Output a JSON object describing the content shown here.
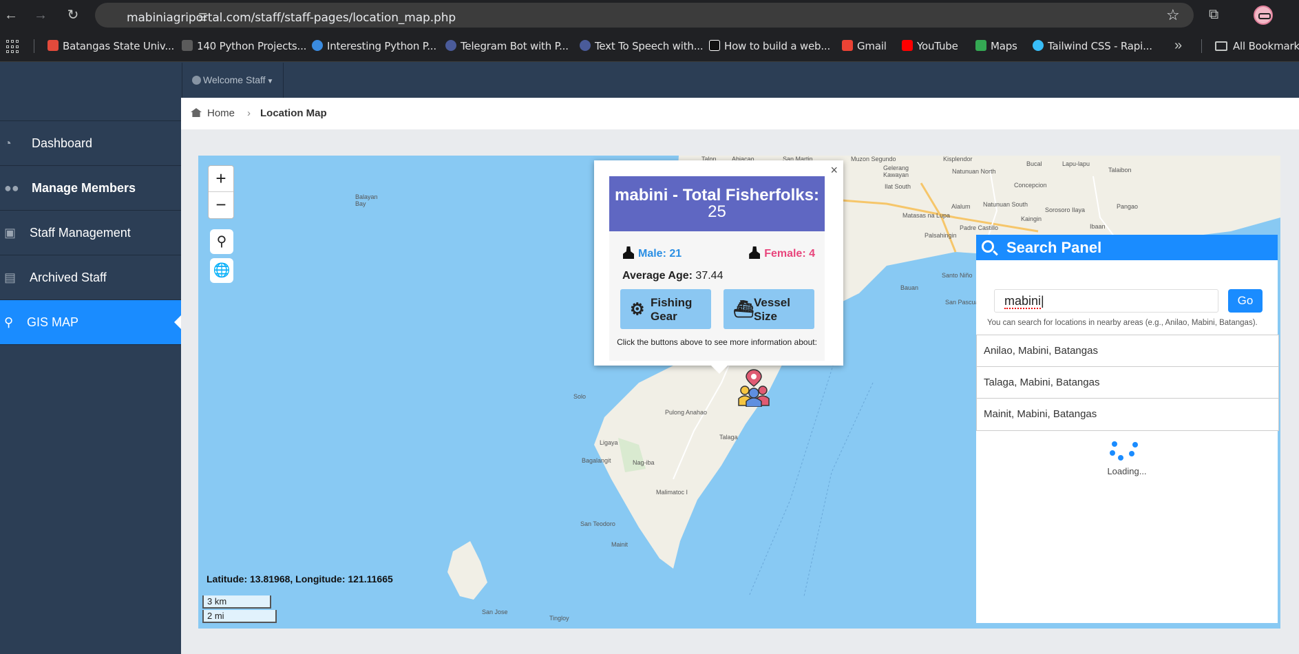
{
  "browser": {
    "url": "mabiniagriportal.com/staff/staff-pages/location_map.php",
    "bookmarks": [
      {
        "label": "Batangas State Univ...",
        "color": "#e24a3b"
      },
      {
        "label": "140 Python Projects...",
        "color": "#5b5b5b"
      },
      {
        "label": "Interesting Python P...",
        "color": "#3a8be0"
      },
      {
        "label": "Telegram Bot with P...",
        "color": "#4a5b9a"
      },
      {
        "label": "Text To Speech with...",
        "color": "#4a5b9a"
      },
      {
        "label": "How to build a web...",
        "color": "#111111"
      },
      {
        "label": "Gmail",
        "color": "#ea4335"
      },
      {
        "label": "YouTube",
        "color": "#ff0000"
      },
      {
        "label": "Maps",
        "color": "#34a853"
      },
      {
        "label": "Tailwind CSS - Rapi...",
        "color": "#38bdf8"
      }
    ],
    "all_bookmarks": "All Bookmarks"
  },
  "header": {
    "welcome": "Welcome Staff"
  },
  "sidebar": {
    "items": [
      {
        "label": "Dashboard",
        "icon": "tachometer-icon"
      },
      {
        "label": "Manage Members",
        "icon": "users-icon"
      },
      {
        "label": "Staff Management",
        "icon": "briefcase-icon"
      },
      {
        "label": "Archived Staff",
        "icon": "archive-icon"
      },
      {
        "label": "GIS MAP",
        "icon": "map-marker-icon"
      }
    ]
  },
  "breadcrumb": {
    "home": "Home",
    "current": "Location Map"
  },
  "map": {
    "coordinates": "Latitude: 13.81968, Longitude: 121.11665",
    "scale_km": "3 km",
    "scale_mi": "2 mi",
    "labels": [
      "Talon",
      "Abiacao",
      "San Martin",
      "Muzon Segundo",
      "Kisplendor",
      "Bucal",
      "Lapu-lapu",
      "Talaibon",
      "Gelerang Kawayan",
      "Natunuan North",
      "Ilat South",
      "Concepcion",
      "Alalum",
      "Natunuan South",
      "Sorosoro Ilaya",
      "Pangao",
      "Matasas na Lupa",
      "Kaingin",
      "Padre Castillo",
      "Ibaan",
      "Balayan Bay",
      "San Jose",
      "Solo",
      "Pulong Anahao",
      "Ligaya",
      "Bagalangit",
      "Nag-iba",
      "Talaga",
      "Malimatoc I",
      "San Teodoro",
      "Mainit",
      "Tingloy",
      "Palsahingin",
      "Santo Niño",
      "Bauan",
      "San Pascual"
    ]
  },
  "popup": {
    "title": "mabini - Total Fisherfolks:",
    "total": "25",
    "male": "Male: 21",
    "female": "Female: 4",
    "avg_label": "Average Age:",
    "avg_value": "37.44",
    "btn_gear": "Fishing Gear",
    "btn_vessel": "Vessel Size",
    "hint": "Click the buttons above to see more information about:"
  },
  "search_panel": {
    "title": "Search Panel",
    "input_value": "mabini",
    "go": "Go",
    "hint": "You can search for locations in nearby areas (e.g., Anilao, Mabini, Batangas).",
    "results": [
      "Anilao, Mabini, Batangas",
      "Talaga, Mabini, Batangas",
      "Mainit, Mabini, Batangas"
    ],
    "loading": "Loading..."
  }
}
